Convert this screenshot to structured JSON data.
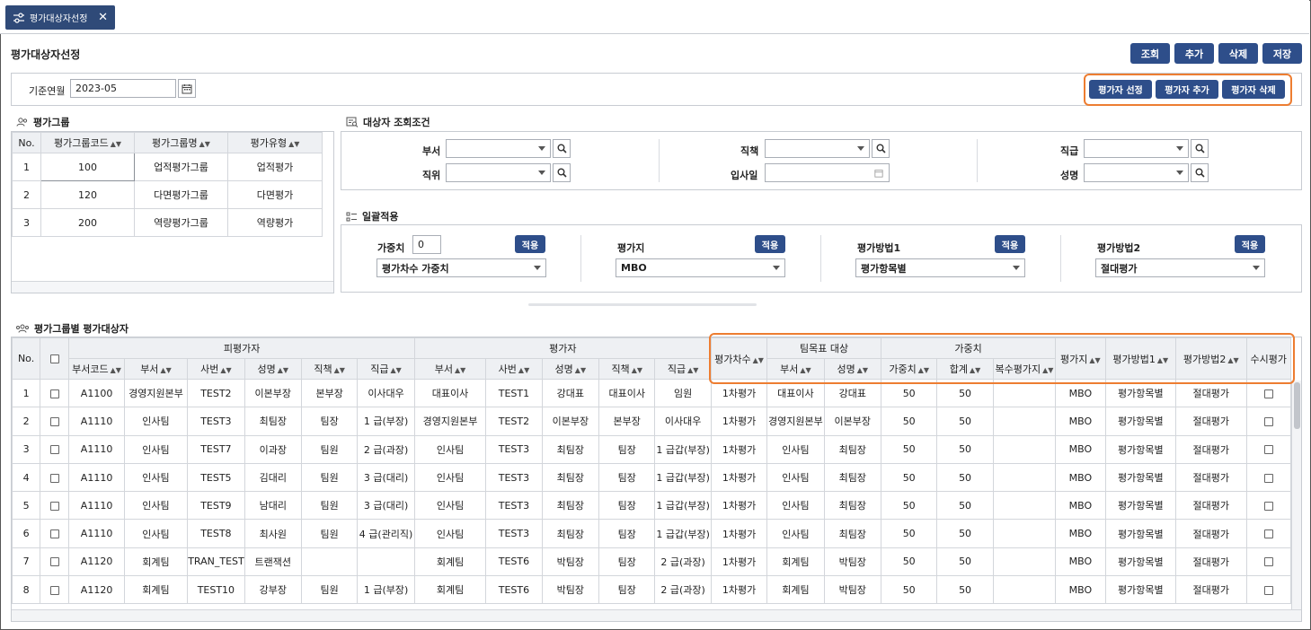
{
  "tab": {
    "label": "평가대상자선정",
    "close": "✕"
  },
  "page": {
    "title": "평가대상자선정"
  },
  "toolbar": {
    "search": "조회",
    "add": "추가",
    "delete": "삭제",
    "save": "저장"
  },
  "filter": {
    "label": "기준연월",
    "value": "2023-05"
  },
  "evaluator_buttons": {
    "select": "평가자 선정",
    "add": "평가자 추가",
    "delete": "평가자 삭제"
  },
  "group": {
    "title": "평가그룹",
    "headers": {
      "no": "No.",
      "code": "평가그룹코드",
      "name": "평가그룹명",
      "type": "평가유형"
    },
    "rows": [
      {
        "no": "1",
        "code": "100",
        "name": "업적평가그룹",
        "type": "업적평가"
      },
      {
        "no": "2",
        "code": "120",
        "name": "다면평가그룹",
        "type": "다면평가"
      },
      {
        "no": "3",
        "code": "200",
        "name": "역량평가그룹",
        "type": "역량평가"
      }
    ]
  },
  "criteria": {
    "title": "대상자 조회조건",
    "dept": "부서",
    "duty": "직책",
    "grade": "직급",
    "position": "직위",
    "hire_date": "입사일",
    "name": "성명"
  },
  "bulk": {
    "title": "일괄적용",
    "weight_label": "가중치",
    "weight_value": "0",
    "weight_select": "평가차수 가중치",
    "evaluator_label": "평가지",
    "evaluator_select": "MBO",
    "method1_label": "평가방법1",
    "method1_select": "평가항목별",
    "method2_label": "평가방법2",
    "method2_select": "절대평가",
    "apply": "적용"
  },
  "targets": {
    "title": "평가그룹별 평가대상자",
    "group_headers": {
      "evaluatee": "피평가자",
      "evaluator": "평가자",
      "team_goal": "팀목표 대상",
      "weight": "가중치"
    },
    "headers": {
      "no": "No.",
      "dept_code": "부서코드",
      "dept": "부서",
      "emp_no": "사번",
      "name": "성명",
      "duty": "직책",
      "grade": "직급",
      "ev_dept": "부서",
      "ev_emp_no": "사번",
      "ev_name": "성명",
      "ev_duty": "직책",
      "ev_grade": "직급",
      "round": "평가차수",
      "tg_dept": "부서",
      "tg_name": "성명",
      "weight": "가중치",
      "total": "합계",
      "multi": "복수평가지",
      "sheet": "평가지",
      "method1": "평가방법1",
      "method2": "평가방법2",
      "adhoc": "수시평가"
    },
    "rows": [
      {
        "no": "1",
        "code": "A1100",
        "dept": "경영지원본부",
        "emp": "TEST2",
        "name": "이본부장",
        "duty": "본부장",
        "grade": "이사대우",
        "edept": "대표이사",
        "eemp": "TEST1",
        "ename": "강대표",
        "eduty": "대표이사",
        "egrade": "임원",
        "round": "1차평가",
        "tdept": "대표이사",
        "tname": "강대표",
        "w": "50",
        "sum": "50",
        "multi": "",
        "sheet": "MBO",
        "m1": "평가항목별",
        "m2": "절대평가"
      },
      {
        "no": "2",
        "code": "A1110",
        "dept": "인사팀",
        "emp": "TEST3",
        "name": "최팀장",
        "duty": "팀장",
        "grade": "1 급(부장)",
        "edept": "경영지원본부",
        "eemp": "TEST2",
        "ename": "이본부장",
        "eduty": "본부장",
        "egrade": "이사대우",
        "round": "1차평가",
        "tdept": "경영지원본부",
        "tname": "이본부장",
        "w": "50",
        "sum": "50",
        "multi": "",
        "sheet": "MBO",
        "m1": "평가항목별",
        "m2": "절대평가"
      },
      {
        "no": "3",
        "code": "A1110",
        "dept": "인사팀",
        "emp": "TEST7",
        "name": "이과장",
        "duty": "팀원",
        "grade": "2 급(과장)",
        "edept": "인사팀",
        "eemp": "TEST3",
        "ename": "최팀장",
        "eduty": "팀장",
        "egrade": "1 급갑(부장)",
        "round": "1차평가",
        "tdept": "인사팀",
        "tname": "최팀장",
        "w": "50",
        "sum": "50",
        "multi": "",
        "sheet": "MBO",
        "m1": "평가항목별",
        "m2": "절대평가"
      },
      {
        "no": "4",
        "code": "A1110",
        "dept": "인사팀",
        "emp": "TEST5",
        "name": "김대리",
        "duty": "팀원",
        "grade": "3 급(대리)",
        "edept": "인사팀",
        "eemp": "TEST3",
        "ename": "최팀장",
        "eduty": "팀장",
        "egrade": "1 급갑(부장)",
        "round": "1차평가",
        "tdept": "인사팀",
        "tname": "최팀장",
        "w": "50",
        "sum": "50",
        "multi": "",
        "sheet": "MBO",
        "m1": "평가항목별",
        "m2": "절대평가"
      },
      {
        "no": "5",
        "code": "A1110",
        "dept": "인사팀",
        "emp": "TEST9",
        "name": "남대리",
        "duty": "팀원",
        "grade": "3 급(대리)",
        "edept": "인사팀",
        "eemp": "TEST3",
        "ename": "최팀장",
        "eduty": "팀장",
        "egrade": "1 급갑(부장)",
        "round": "1차평가",
        "tdept": "인사팀",
        "tname": "최팀장",
        "w": "50",
        "sum": "50",
        "multi": "",
        "sheet": "MBO",
        "m1": "평가항목별",
        "m2": "절대평가"
      },
      {
        "no": "6",
        "code": "A1110",
        "dept": "인사팀",
        "emp": "TEST8",
        "name": "최사원",
        "duty": "팀원",
        "grade": "4 급(관리직)",
        "edept": "인사팀",
        "eemp": "TEST3",
        "ename": "최팀장",
        "eduty": "팀장",
        "egrade": "1 급갑(부장)",
        "round": "1차평가",
        "tdept": "인사팀",
        "tname": "최팀장",
        "w": "50",
        "sum": "50",
        "multi": "",
        "sheet": "MBO",
        "m1": "평가항목별",
        "m2": "절대평가"
      },
      {
        "no": "7",
        "code": "A1120",
        "dept": "회계팀",
        "emp": "TRAN_TEST",
        "name": "트랜잭션",
        "duty": "",
        "grade": "",
        "edept": "회계팀",
        "eemp": "TEST6",
        "ename": "박팀장",
        "eduty": "팀장",
        "egrade": "2 급(과장)",
        "round": "1차평가",
        "tdept": "회계팀",
        "tname": "박팀장",
        "w": "50",
        "sum": "50",
        "multi": "",
        "sheet": "MBO",
        "m1": "평가항목별",
        "m2": "절대평가"
      },
      {
        "no": "8",
        "code": "A1120",
        "dept": "회계팀",
        "emp": "TEST10",
        "name": "강부장",
        "duty": "팀원",
        "grade": "1 급(부장)",
        "edept": "회계팀",
        "eemp": "TEST6",
        "ename": "박팀장",
        "eduty": "팀장",
        "egrade": "2 급(과장)",
        "round": "1차평가",
        "tdept": "회계팀",
        "tname": "박팀장",
        "w": "50",
        "sum": "50",
        "multi": "",
        "sheet": "MBO",
        "m1": "평가항목별",
        "m2": "절대평가"
      }
    ]
  },
  "colors": {
    "primary": "#2e4e8a",
    "tab": "#2f4a78",
    "highlight": "#ed7d31",
    "header_bg": "#eef0f3"
  }
}
